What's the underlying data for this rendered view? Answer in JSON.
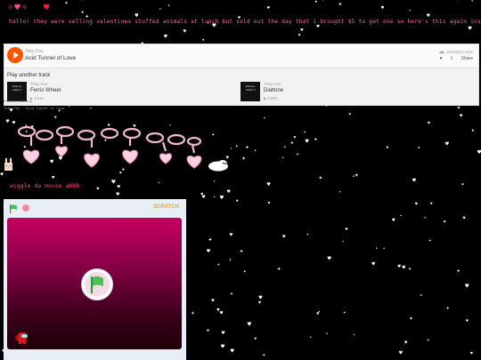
{
  "header": {
    "sparkle_icon": "sparkle-hearts-icon",
    "heart_icon": "heart-icon",
    "marquee_text": "hallo! they were selling valentines stuffed animals at lunch but sold out the day that i brought $5 to get one so here's this again instead"
  },
  "soundcloud": {
    "artist": "Toby Fox",
    "title": "Acid Tunnel of Love",
    "logo_label": "SOUNDCLOUD",
    "share_label": "Share",
    "another_label": "Play another track",
    "tracks": [
      {
        "artist": "Toby Fox",
        "title": "Ferris Wheel",
        "plays": "▶ 3.81K",
        "art_text": "deltarune chapter 2"
      },
      {
        "artist": "Toby Fox",
        "title": "Dialtone",
        "plays": "▶ 3.88K",
        "art_text": "deltarune chapter 2"
      }
    ],
    "privacy": "Privacy policy",
    "credit": "Toby Fox · Acid Tunnel of Love"
  },
  "decorations": {
    "wiggle_text": "wiggle da mouse ahhh"
  },
  "scratch": {
    "brand": "SCRATCH",
    "colors": {
      "stage_top": "#c4005f",
      "stage_bottom": "#1e0008",
      "flag": "#4cbf56"
    }
  }
}
